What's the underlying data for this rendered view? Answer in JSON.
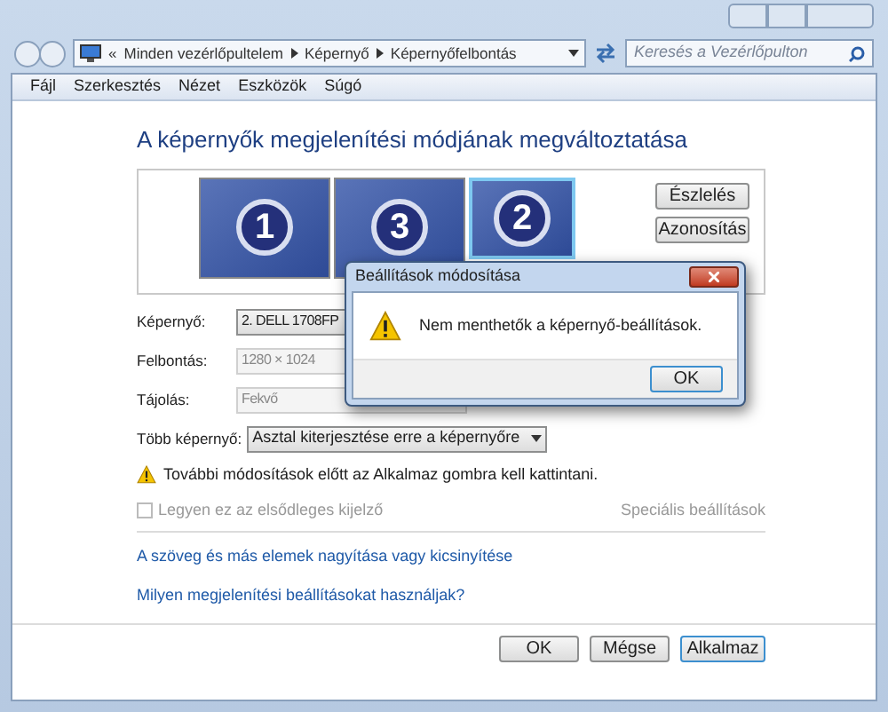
{
  "address_bar": {
    "overflow": "«",
    "breadcrumbs": [
      "Minden vezérlőpultelem",
      "Képernyő",
      "Képernyőfelbontás"
    ]
  },
  "search": {
    "placeholder": "Keresés a Vezérlőpulton"
  },
  "menu": [
    "Fájl",
    "Szerkesztés",
    "Nézet",
    "Eszközök",
    "Súgó"
  ],
  "heading": "A képernyők megjelenítési módjának megváltoztatása",
  "monitors": [
    {
      "number": "1",
      "selected": false
    },
    {
      "number": "3",
      "selected": false
    },
    {
      "number": "2",
      "selected": true
    }
  ],
  "side_buttons": [
    "Észlelés",
    "Azonosítás"
  ],
  "fields": [
    {
      "label": "Képernyő:",
      "value": "2. DELL 1708FP",
      "disabled": false,
      "kind": "text"
    },
    {
      "label": "Felbontás:",
      "value": "1280 × 1024",
      "disabled": true,
      "kind": "text"
    },
    {
      "label": "Tájolás:",
      "value": "Fekvő",
      "disabled": true,
      "kind": "text"
    },
    {
      "label": "Több képernyő:",
      "value": "Asztal kiterjesztése erre a képernyőre",
      "disabled": false,
      "kind": "select"
    }
  ],
  "notice": "További módosítások előtt az Alkalmaz gombra kell kattintani.",
  "primary_checkbox": {
    "label": "Legyen ez az elsődleges kijelző",
    "checked": false,
    "disabled": true
  },
  "advanced_link": {
    "label": "Speciális beállítások",
    "disabled": true
  },
  "links": [
    "A szöveg és más elemek nagyítása vagy kicsinyítése",
    "Milyen megjelenítési beállításokat használjak?"
  ],
  "buttons": [
    {
      "label": "OK",
      "default": false
    },
    {
      "label": "Mégse",
      "default": false
    },
    {
      "label": "Alkalmaz",
      "default": true
    }
  ],
  "dialog": {
    "title": "Beállítások módosítása",
    "message": "Nem menthetők a képernyő-beállítások.",
    "button": "OK"
  }
}
